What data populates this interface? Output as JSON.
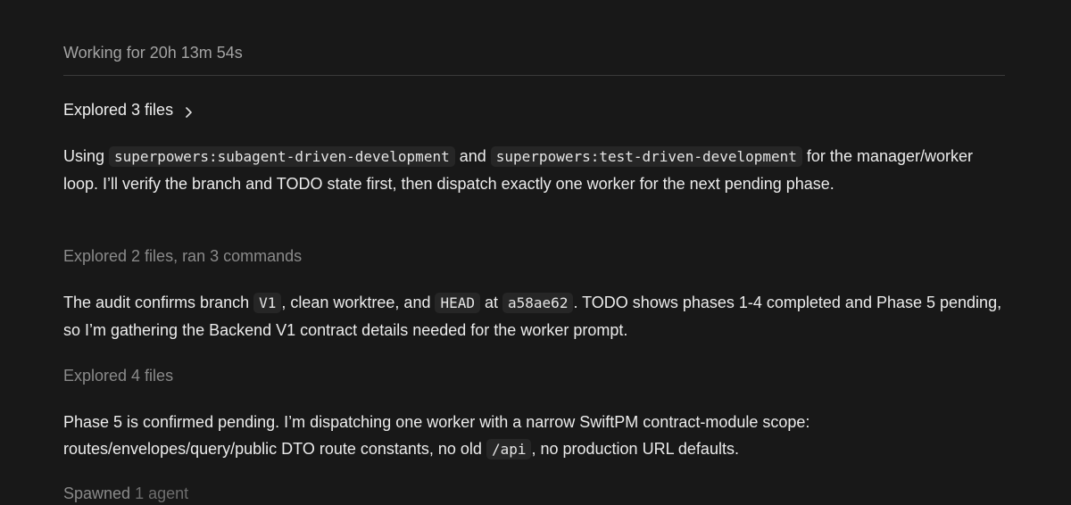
{
  "status": {
    "working": "Working for 20h 13m 54s"
  },
  "explored_main": {
    "label": "Explored 3 files"
  },
  "message1": {
    "t1": "Using ",
    "code1": "superpowers:subagent-driven-development",
    "t2": " and ",
    "code2": "superpowers:test-driven-development",
    "t3": " for the manager/worker loop. I’ll verify the branch and TODO state first, then dispatch exactly one worker for the next pending phase."
  },
  "meta1": "Explored 2 files, ran 3 commands",
  "message2": {
    "t1": "The audit confirms branch ",
    "code1": "V1",
    "t2": ", clean worktree, and ",
    "code2": "HEAD",
    "t3": " at ",
    "code3": "a58ae62",
    "t4": ". TODO shows phases 1-4 completed and Phase 5 pending, so I’m gathering the Backend V1 contract details needed for the worker prompt."
  },
  "meta2": "Explored 4 files",
  "message3": {
    "t1": "Phase 5 is confirmed pending. I’m dispatching one worker with a narrow SwiftPM contract-module scope: routes/envelopes/query/public DTO route constants, no old ",
    "code1": "/api",
    "t2": ", no production URL defaults."
  },
  "meta3": {
    "a": "Spawned",
    "b": " 1 agent"
  },
  "colors": {
    "background": "#181818",
    "text": "#ececec",
    "muted": "#8a8a8a",
    "code_bg": "#262626"
  },
  "icons": {
    "explored_chevron": "chevron-right-icon"
  }
}
